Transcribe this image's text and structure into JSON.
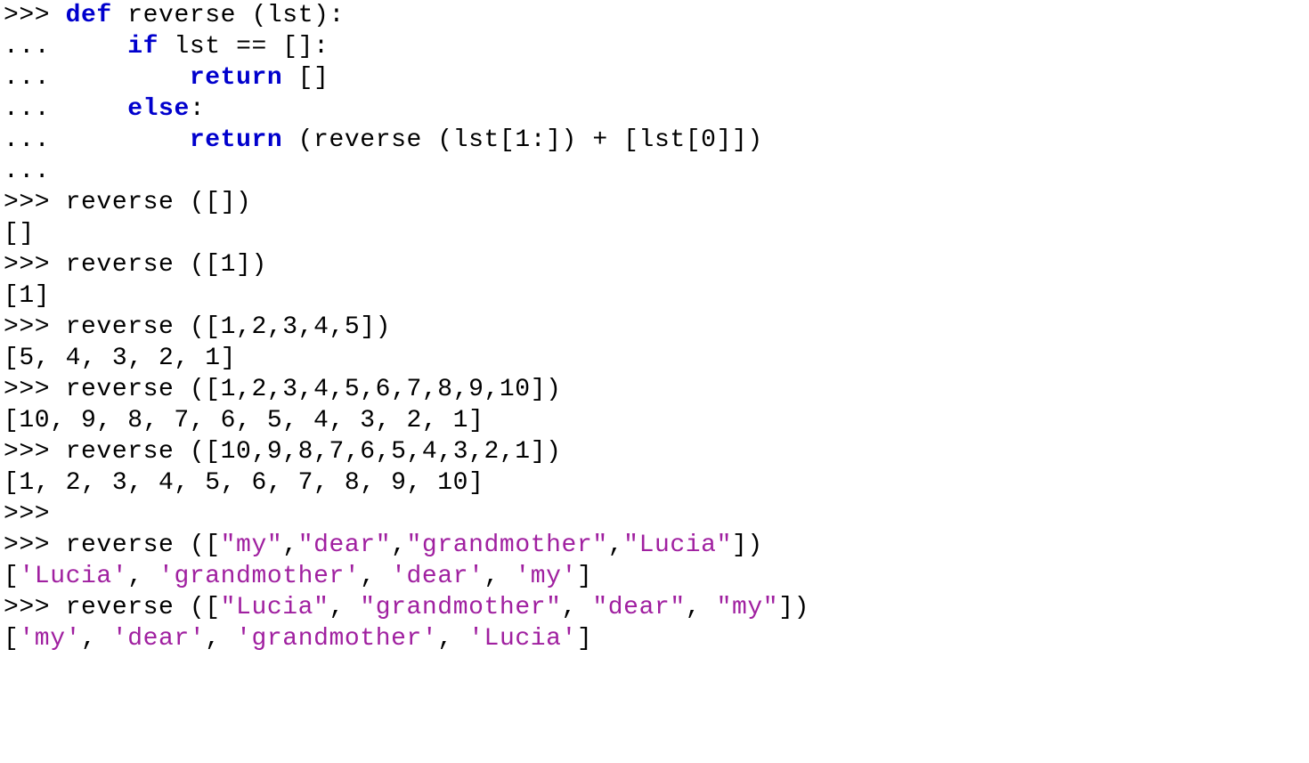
{
  "prompts": {
    "primary": ">>> ",
    "cont": "... "
  },
  "keywords": {
    "def": "def",
    "if": "if",
    "return": "return",
    "else": "else"
  },
  "def_line": {
    "space_after_def": " ",
    "fn_name": "reverse",
    "after_name": " (lst):"
  },
  "body": {
    "indent1": "    ",
    "indent2": "        ",
    "if_cond": " lst == []:",
    "ret_empty": " []",
    "else_colon": ":",
    "ret_expr": " (reverse (lst[1:]) + [lst[0]])"
  },
  "calls": {
    "c1": "reverse ([])",
    "r1": "[]",
    "c2": "reverse ([1])",
    "r2": "[1]",
    "c3": "reverse ([1,2,3,4,5])",
    "r3": "[5, 4, 3, 2, 1]",
    "c4": "reverse ([1,2,3,4,5,6,7,8,9,10])",
    "r4": "[10, 9, 8, 7, 6, 5, 4, 3, 2, 1]",
    "c5": "reverse ([10,9,8,7,6,5,4,3,2,1])",
    "r5": "[1, 2, 3, 4, 5, 6, 7, 8, 9, 10]",
    "empty_prompt": ">>>",
    "c6_pre": "reverse ([",
    "c6_s1": "\"my\"",
    "c6_s2": "\"dear\"",
    "c6_s3": "\"grandmother\"",
    "c6_s4": "\"Lucia\"",
    "comma": ",",
    "comma_sp": ", ",
    "close": "])",
    "r6_open": "[",
    "r6_s1": "'Lucia'",
    "r6_s2": "'grandmother'",
    "r6_s3": "'dear'",
    "r6_s4": "'my'",
    "r6_close": "]",
    "c7_pre": "reverse ([",
    "c7_s1": "\"Lucia\"",
    "c7_s2": "\"grandmother\"",
    "c7_s3": "\"dear\"",
    "c7_s4": "\"my\"",
    "r7_s1": "'my'",
    "r7_s2": "'dear'",
    "r7_s3": "'grandmother'",
    "r7_s4": "'Lucia'"
  }
}
